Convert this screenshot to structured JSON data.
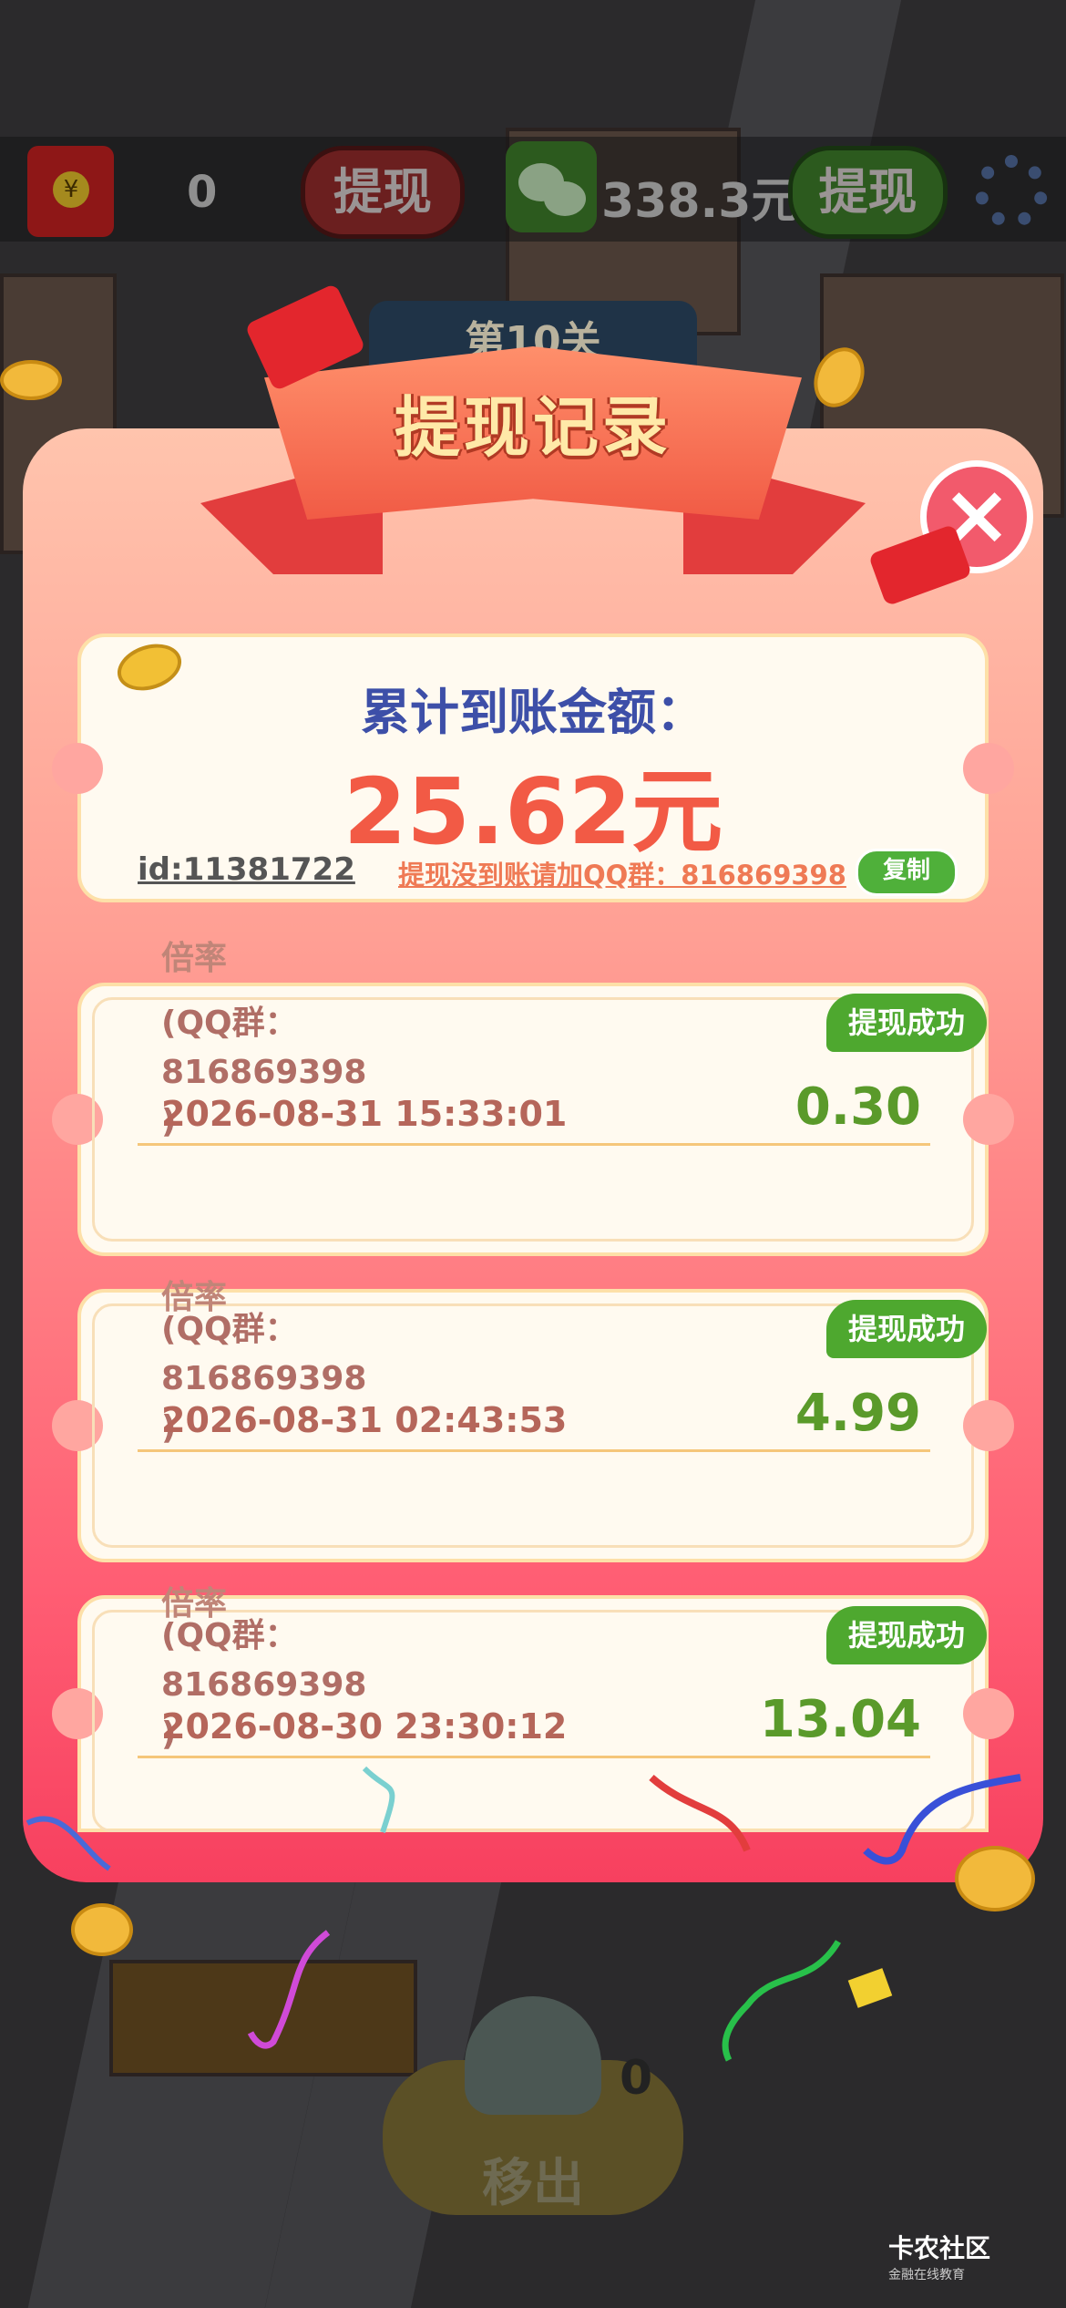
{
  "header": {
    "red_balance": "0",
    "withdraw_label_1": "提现",
    "wechat_balance": "338.3元",
    "withdraw_label_2": "提现",
    "level": "第10关"
  },
  "modal": {
    "title": "提现记录",
    "summary": {
      "label": "累计到账金额：",
      "amount": "25.62元",
      "user_id": "id:11381722",
      "qq_notice": "提现没到账请加QQ群：816869398",
      "copy_label": "复制"
    },
    "records": [
      {
        "rate": "倍率",
        "note": "(QQ群：\n816869398",
        "paren": ")",
        "date": "2026-08-31 15:33:01",
        "amount": "0.30",
        "status": "提现成功"
      },
      {
        "rate": "倍率",
        "note": "(QQ群：\n816869398",
        "paren": ")",
        "date": "2026-08-31 02:43:53",
        "amount": "4.99",
        "status": "提现成功"
      },
      {
        "rate": "倍率",
        "note": "(QQ群：\n816869398",
        "paren": ")",
        "date": "2026-08-30 23:30:12",
        "amount": "13.04",
        "status": "提现成功"
      }
    ]
  },
  "bottom": {
    "move_out_label": "移出",
    "count": "0"
  },
  "watermark": {
    "brand": "卡农社区",
    "tagline": "金融在线教育"
  },
  "colors": {
    "accent_green": "#4ea82f",
    "amount_red": "#f25a45",
    "label_blue": "#3d4fa8"
  }
}
